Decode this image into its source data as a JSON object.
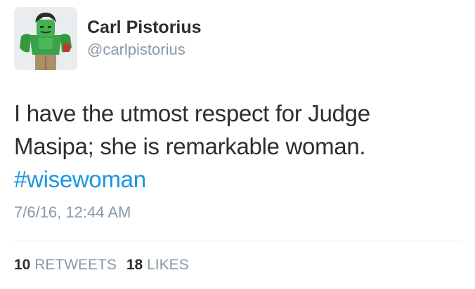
{
  "user": {
    "display_name": "Carl Pistorius",
    "handle": "@carlpistorius",
    "avatar_icon": "hulk-lego-minifigure-avatar"
  },
  "tweet": {
    "text_lines": [
      "I have the utmost respect for Judge",
      "Masipa; she is remarkable woman."
    ],
    "hashtag": "#wisewoman",
    "timestamp": "7/6/16, 12:44 AM"
  },
  "stats": {
    "retweets_count": "10",
    "retweets_label": "RETWEETS",
    "likes_count": "18",
    "likes_label": "LIKES"
  },
  "colors": {
    "hashtag": "#1b95e0",
    "secondary_text": "#8899a6",
    "primary_text": "#292f33"
  }
}
